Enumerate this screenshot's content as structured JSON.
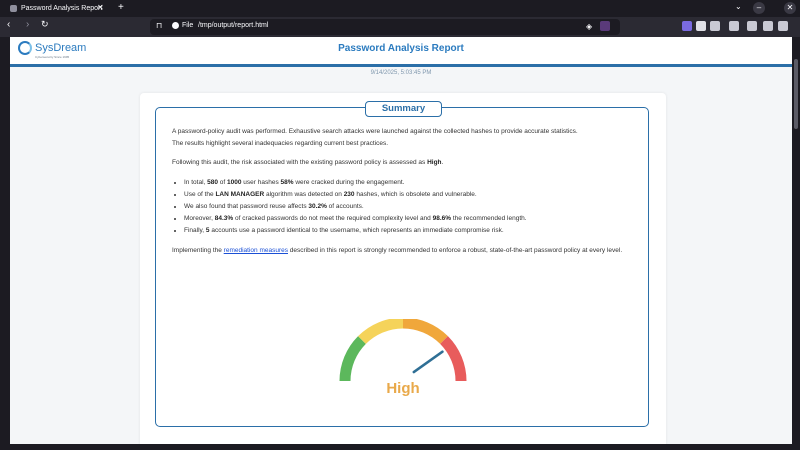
{
  "browser": {
    "tab_title": "Password Analysis Report",
    "url_scheme": "File",
    "url": "/tmp/output/report.html",
    "extension_badge": "9"
  },
  "header": {
    "logo_name": "SysDream",
    "logo_tagline": "Cybersecurity Since 1995",
    "title": "Password Analysis Report"
  },
  "date": "9/14/2025, 5:03:45 PM",
  "summary": {
    "heading": "Summary",
    "intro_1": "A password-policy audit was performed. Exhaustive search attacks were launched against the collected hashes to provide accurate statistics.",
    "intro_2": "The results highlight several inadequacies regarding current best practices.",
    "risk_pre": "Following this audit, the risk associated with the existing password policy is assessed as ",
    "risk_value": "High",
    "risk_post": ".",
    "bullets": [
      {
        "pre": "In total, ",
        "b1": "580",
        "mid1": " of ",
        "b2": "1000",
        "mid2": " user hashes ",
        "b3": "58%",
        "post": " were cracked during the engagement."
      },
      {
        "pre": "Use of the ",
        "b1": "LAN MANAGER",
        "mid1": " algorithm was detected on ",
        "b2": "230",
        "post": " hashes, which is obsolete and vulnerable."
      },
      {
        "pre": "We also found that password reuse affects ",
        "b1": "30.2%",
        "post": " of accounts."
      },
      {
        "pre": "Moreover, ",
        "b1": "84.3%",
        "mid1": " of cracked passwords do not meet the required complexity level and ",
        "b2": "98.6%",
        "post": " the recommended length."
      },
      {
        "pre": "Finally, ",
        "b1": "5",
        "post": " accounts use a password identical to the username, which represents an immediate compromise risk."
      }
    ],
    "closing_pre": "Implementing the ",
    "closing_link": "remediation measures",
    "closing_post": " described in this report is strongly recommended to enforce a robust, state-of-the-art password policy at every level."
  },
  "gauge": {
    "label": "High",
    "level": 0.78,
    "colors": {
      "green": "#5cb85c",
      "yellow": "#f5d35a",
      "orange": "#f0a73b",
      "red": "#e85c5c",
      "needle": "#2f6f95",
      "label": "#e9a94a"
    }
  },
  "colors": {
    "accent": "#2b6fa8",
    "link": "#1a4fd6"
  }
}
